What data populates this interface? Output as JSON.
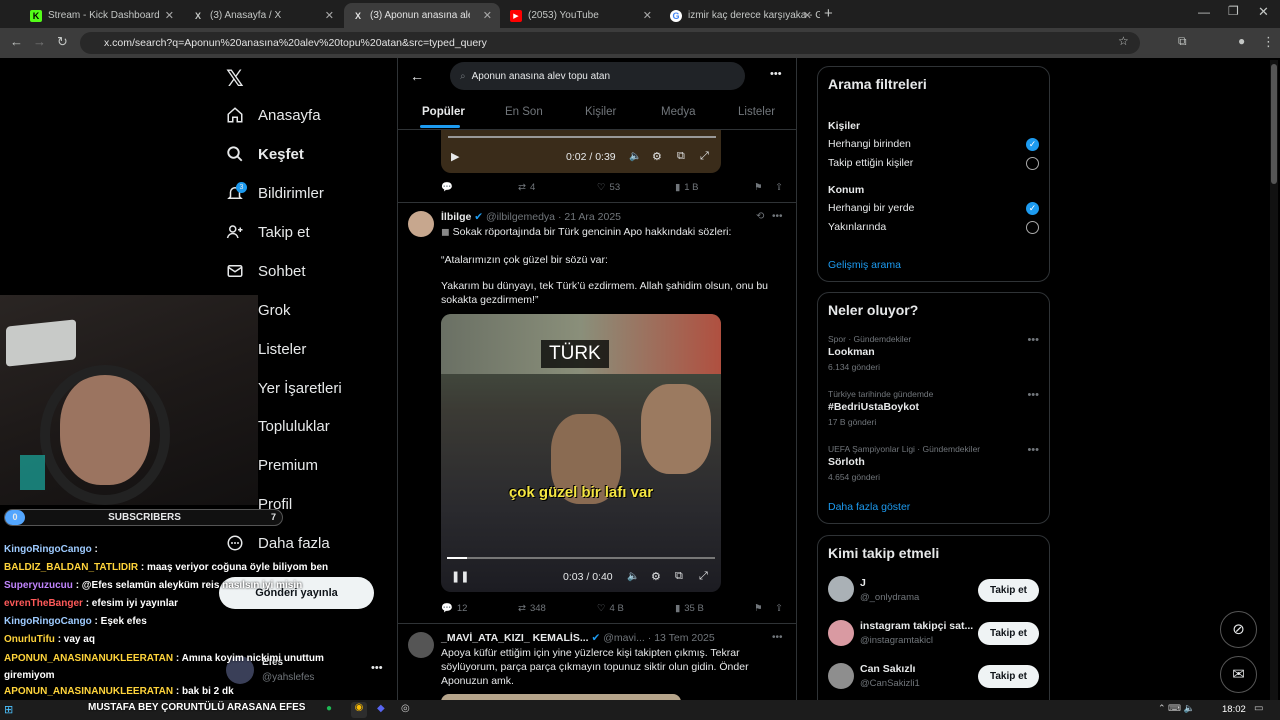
{
  "browser": {
    "tabs": [
      {
        "title": "Stream - Kick Dashboard",
        "icon": "K",
        "color": "#53fc18"
      },
      {
        "title": "(3) Anasayfa / X",
        "icon": "X",
        "color": "#ffffff"
      },
      {
        "title": "(3) Aponun anasına alev to",
        "icon": "X",
        "color": "#ffffff"
      },
      {
        "title": "(2053) YouTube",
        "icon": "▶",
        "color": "#ff0000"
      },
      {
        "title": "izmir kaç derece karşıyaka - Go",
        "icon": "G",
        "color": "#4285f4"
      }
    ],
    "url": "x.com/search?q=Aponun%20anasına%20alev%20topu%20atan&src=typed_query"
  },
  "nav": {
    "items": [
      "Anasayfa",
      "Keşfet",
      "Bildirimler",
      "Takip et",
      "Sohbet",
      "Grok",
      "Listeler",
      "Yer İşaretleri",
      "Topluluklar",
      "Premium",
      "Profil",
      "Daha fazla"
    ],
    "notif_badge": "3",
    "post_button": "Gönderi yayınla"
  },
  "account": {
    "name": "Efes",
    "handle": "@yahslefes"
  },
  "search": {
    "query": "Aponun anasına alev topu atan"
  },
  "tabs": [
    "Popüler",
    "En Son",
    "Kişiler",
    "Medya",
    "Listeler"
  ],
  "post1": {
    "time": "0:02 / 0:39",
    "replies": "",
    "retweets": "4",
    "likes": "53",
    "views": "1 B"
  },
  "post2": {
    "name": "İlbilge",
    "handle": "@ilbilgemedya",
    "date": "21 Ara 2025",
    "line1": "Sokak röportajında bir Türk gencinin Apo hakkındaki sözleri:",
    "line2": "“Atalarımızın çok güzel bir sözü var:",
    "line3": "Yakarım bu dünyayı, tek Türk’ü ezdirmem.  Allah şahidim olsun, onu bu",
    "line4": "sokakta gezdirmem!”",
    "video_caption_top": "TÜRK",
    "video_caption_bottom": "çok güzel bir lafı var",
    "time": "0:03 / 0:40",
    "replies": "12",
    "retweets": "348",
    "likes": "4 B",
    "views": "35 B"
  },
  "post3": {
    "name": "_MAVİ_ATA_KIZI_ KEMALİS...",
    "handle": "@mavi...",
    "date": "13 Tem 2025",
    "text1": "Apoya küfür ettiğim için yine yüzlerce kişi takipten çıkmış. Tekrar",
    "text2": "söylüyorum, parça parça çıkmayın topunuz siktir olun gidin. Önder",
    "text3": "Aponuzun amk."
  },
  "filters": {
    "title": "Arama filtreleri",
    "people": "Kişiler",
    "opt1": "Herhangi birinden",
    "opt2": "Takip ettiğin kişiler",
    "location": "Konum",
    "opt3": "Herhangi bir yerde",
    "opt4": "Yakınlarında",
    "advanced": "Gelişmiş arama"
  },
  "trends": {
    "title": "Neler oluyor?",
    "items": [
      {
        "cat": "Spor · Gündemdekiler",
        "name": "Lookman",
        "count": "6.134 gönderi"
      },
      {
        "cat": "Türkiye tarihinde gündemde",
        "name": "#BedriUstaBoykot",
        "count": "17 B gönderi"
      },
      {
        "cat": "UEFA Şampiyonlar Ligi · Gündemdekiler",
        "name": "Sörloth",
        "count": "4.654 gönderi"
      }
    ],
    "more": "Daha fazla göster"
  },
  "whotofollow": {
    "title": "Kimi takip etmeli",
    "button": "Takip et",
    "users": [
      {
        "name": "J",
        "handle": "@_onlydrama"
      },
      {
        "name": "instagram takipçi sat...",
        "handle": "@instagramtakicl"
      },
      {
        "name": "Can Sakızlı",
        "handle": "@CanSakizli1"
      }
    ]
  },
  "overlay": {
    "subs_label": "SUBSCRIBERS",
    "subs_left": "0",
    "subs_right": "7",
    "chat": [
      {
        "user": "KingoRingoCango",
        "msg": ":",
        "color": "#9ecbff"
      },
      {
        "user": "BALDIZ_BALDAN_TATLIDIR",
        "msg": ": maaş veriyor coğuna öyle biliyom ben",
        "color": "#ffd43b"
      },
      {
        "user": "Superyuzucuu",
        "msg": ": @Efes selamün aleyküm reis nasılsın iyi misin",
        "color": "#c084fc"
      },
      {
        "user": "evrenTheBanger",
        "msg": ": efesim iyi yayınlar",
        "color": "#ff5a5a"
      },
      {
        "user": "KingoRingoCango",
        "msg": ": Eşek efes",
        "color": "#9ecbff"
      },
      {
        "user": "OnurluTifu",
        "msg": ": vay aq",
        "color": "#ffd43b"
      },
      {
        "user": "APONUN_ANASINANUKLEERATAN",
        "msg": ": Amına koyim nickimi unuttum",
        "color": "#ffd43b"
      },
      {
        "user": "",
        "msg": "giremiyom",
        "color": "#ffd43b"
      },
      {
        "user": "APONUN_ANASINANUKLEERATAN",
        "msg": ": bak bi 2 dk",
        "color": "#ffd43b"
      }
    ],
    "ticker": "MUSTAFA BEY ÇORUNTÜLÜ ARASANA EFES"
  },
  "taskbar": {
    "time": "18:02"
  }
}
